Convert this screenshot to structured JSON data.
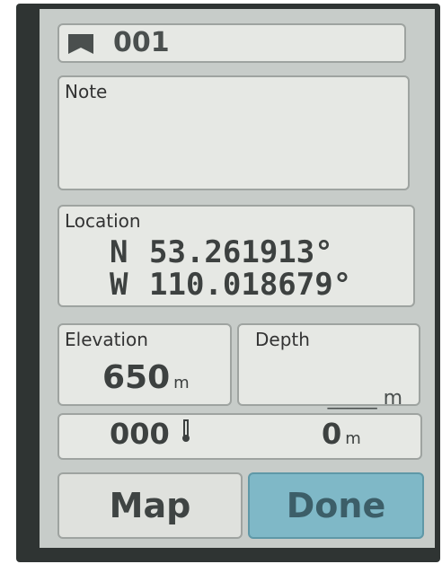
{
  "waypoint": {
    "name": "001"
  },
  "note": {
    "label": "Note",
    "value": ""
  },
  "location": {
    "label": "Location",
    "lat_dir": "N",
    "lat": "53.261913°",
    "lon_dir": "W",
    "lon": "110.018679°"
  },
  "elevation": {
    "label": "Elevation",
    "value": "650",
    "unit": "m"
  },
  "depth": {
    "label": "Depth",
    "value": "_____",
    "unit": "m"
  },
  "counter": {
    "left_value": "000",
    "left_icon": "temperature-icon",
    "right_value": "0",
    "right_unit": "m"
  },
  "buttons": {
    "map": "Map",
    "done": "Done"
  },
  "colors": {
    "done_button": "#7fb8c7",
    "panel": "#e6e8e4",
    "screen": "#c7ccc9"
  }
}
